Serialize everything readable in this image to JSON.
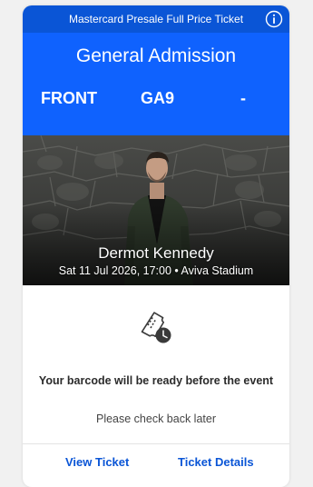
{
  "ticket": {
    "tier": "Mastercard Presale Full Price Ticket",
    "admission": "General Admission",
    "section": "FRONT",
    "row": "GA9",
    "seat": "-"
  },
  "event": {
    "name": "Dermot Kennedy",
    "details": "Sat 11 Jul 2026, 17:00 • Aviva Stadium"
  },
  "barcode": {
    "message": "Your barcode will be ready before the event",
    "subtext": "Please check back later"
  },
  "actions": {
    "view_ticket": "View Ticket",
    "ticket_details": "Ticket Details"
  },
  "icons": {
    "info": "info-icon",
    "ticket_clock": "ticket-clock-icon"
  },
  "colors": {
    "header_dark_blue": "#0a55d6",
    "header_blue": "#0f62fe",
    "link_blue": "#0a55d6"
  }
}
